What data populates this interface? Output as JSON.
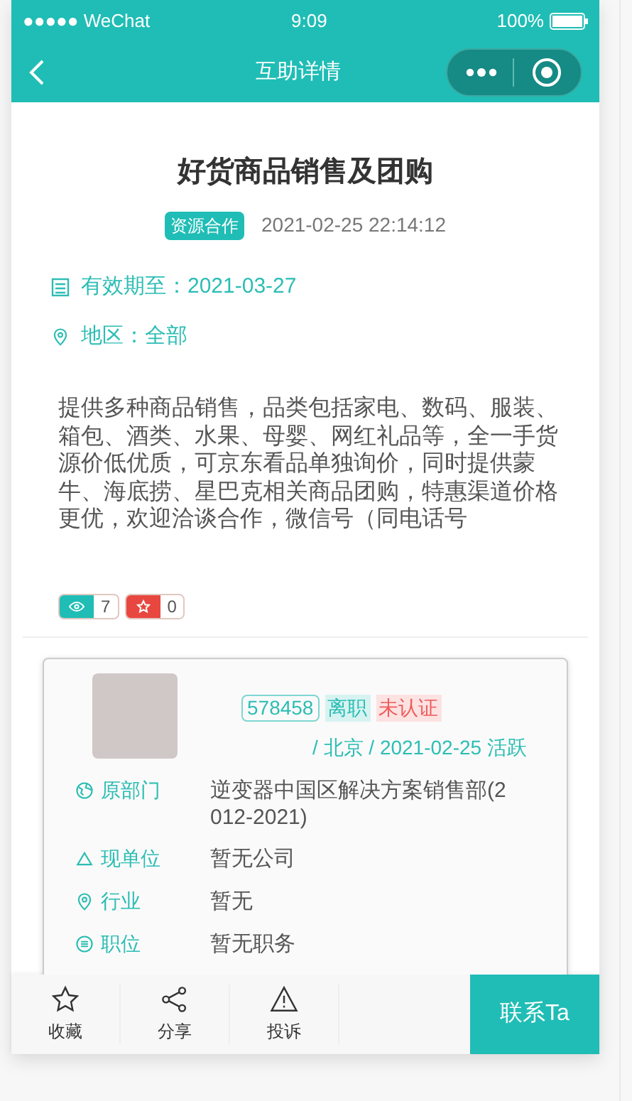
{
  "status_bar": {
    "carrier": "●●●●● WeChat",
    "time": "9:09",
    "battery": "100%"
  },
  "nav": {
    "title": "互助详情"
  },
  "post": {
    "title": "好货商品销售及团购",
    "tag": "资源合作",
    "datetime": "2021-02-25 22:14:12",
    "valid_until": "有效期至：2021-03-27",
    "region": "地区：全部",
    "description": "提供多种商品销售，品类包括家电、数码、服装、箱包、酒类、水果、母婴、网红礼品等，全一手货源价低优质，可京东看品单独询价，同时提供蒙牛、海底捞、星巴克相关商品团购，特惠渠道价格更优，欢迎洽谈合作，微信号（同电话号",
    "views": "7",
    "favorites": "0"
  },
  "user": {
    "id": "578458",
    "badges": [
      {
        "label": "离职",
        "kind": "status"
      },
      {
        "label": "未认证",
        "kind": "warning"
      }
    ],
    "meta": "/ 北京 / 2021-02-25 活跃",
    "fields": [
      {
        "kind": "globe",
        "label": "原部门",
        "value": "逆变器中国区解决方案销售部(2012-2021)"
      },
      {
        "kind": "triangle",
        "label": "现单位",
        "value": "暂无公司"
      },
      {
        "kind": "pin",
        "label": "行业",
        "value": "暂无"
      },
      {
        "kind": "list",
        "label": "职位",
        "value": "暂无职务"
      }
    ]
  },
  "bottom_bar": {
    "actions": [
      {
        "kind": "star",
        "label": "收藏"
      },
      {
        "kind": "share",
        "label": "分享"
      },
      {
        "kind": "warning",
        "label": "投诉"
      }
    ],
    "contact_button": "联系Ta"
  }
}
